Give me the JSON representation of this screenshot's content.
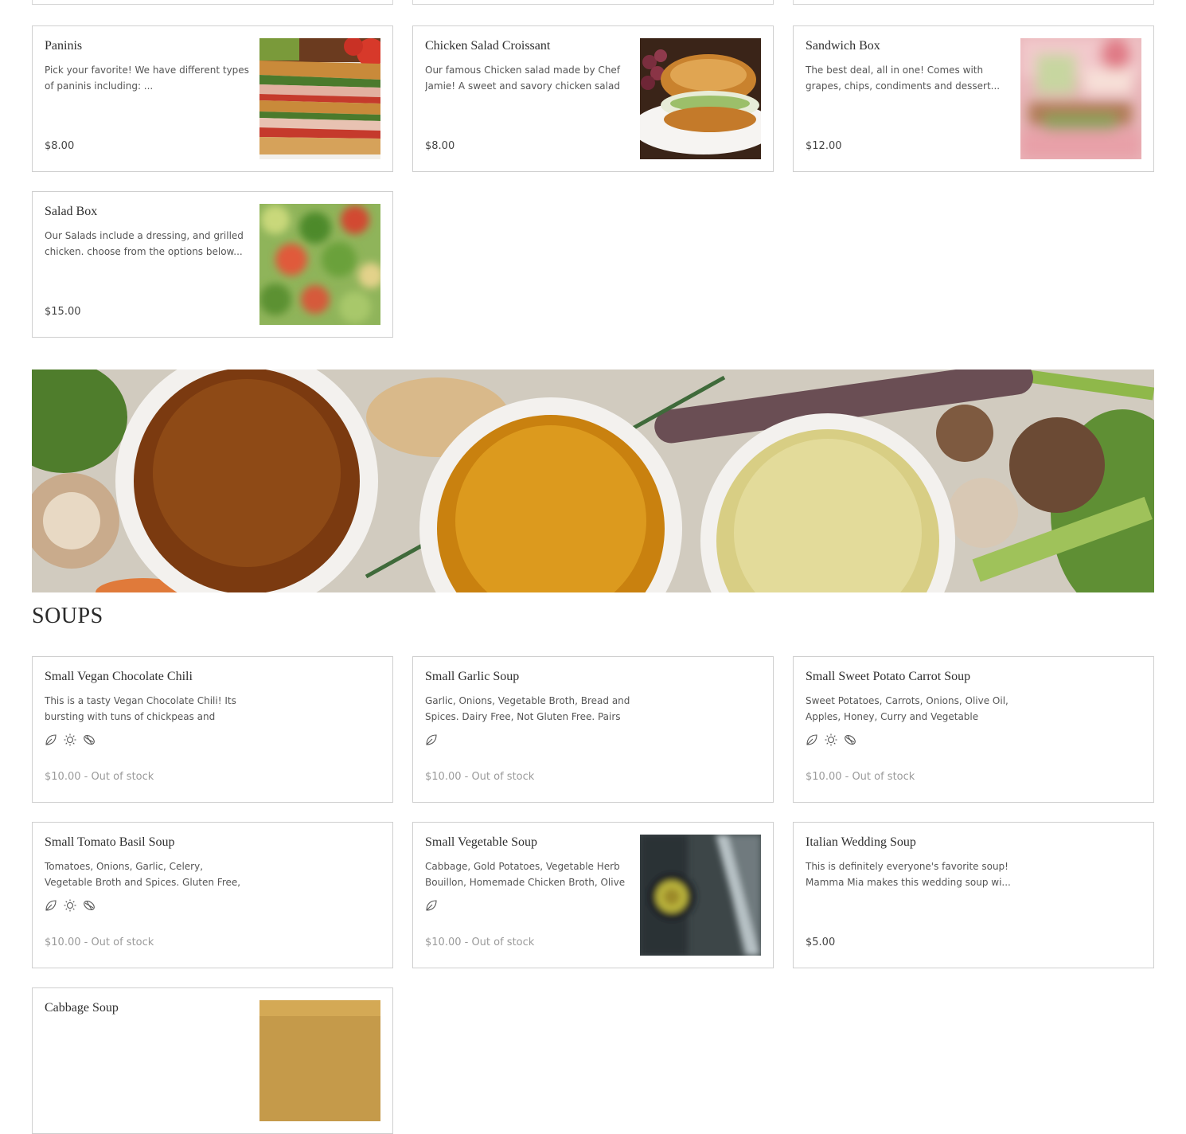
{
  "sandwiches": [
    {
      "title": "Paninis",
      "desc": "Pick your favorite! We have different types of paninis including: ...",
      "price": "$8.00",
      "image": "panini-photo"
    },
    {
      "title": "Chicken Salad Croissant",
      "desc": "Our famous Chicken salad made by Chef Jamie! A sweet and savory chicken salad ...",
      "price": "$8.00",
      "image": "croissant-photo"
    },
    {
      "title": "Sandwich Box",
      "desc": "The best deal, all in one! Comes with grapes, chips, condiments and dessert...",
      "price": "$12.00",
      "image": "sandwich-box-photo"
    },
    {
      "title": "Salad Box",
      "desc": "Our Salads include a dressing, and grilled chicken. choose from the options below...",
      "price": "$15.00",
      "image": "salad-photo"
    }
  ],
  "soups_section": {
    "title": "SOUPS"
  },
  "soups": [
    {
      "title": "Small Vegan Chocolate Chili",
      "desc": "This is a tasty Vegan Chocolate Chili! Its bursting with tuns of chickpeas and white...",
      "price": "$10.00 - Out of stock",
      "icons": [
        "vegan-leaf-icon",
        "spicy-sun-icon",
        "gluten-free-icon"
      ]
    },
    {
      "title": "Small Garlic Soup",
      "desc": "Garlic, Onions, Vegetable Broth, Bread and Spices. Dairy Free, Not Gluten Free. Pairs ...",
      "price": "$10.00 - Out of stock",
      "icons": [
        "vegan-leaf-icon"
      ]
    },
    {
      "title": "Small Sweet Potato Carrot Soup",
      "desc": "Sweet Potatoes, Carrots, Onions, Olive Oil, Apples, Honey, Curry and Vegetable Broth....",
      "price": "$10.00 - Out of stock",
      "icons": [
        "vegan-leaf-icon",
        "spicy-sun-icon",
        "gluten-free-icon"
      ]
    },
    {
      "title": "Small Tomato Basil Soup",
      "desc": "Tomatoes, Onions, Garlic, Celery, Vegetable Broth and Spices. Gluten Free, Dairy Free ...",
      "price": "$10.00 - Out of stock",
      "icons": [
        "vegan-leaf-icon",
        "spicy-sun-icon",
        "gluten-free-icon"
      ]
    },
    {
      "title": "Small Vegetable Soup",
      "desc": "Cabbage, Gold Potatoes, Vegetable Herb Bouillon, Homemade Chicken Broth, Olive ...",
      "price": "$10.00 - Out of stock",
      "icons": [
        "vegan-leaf-icon"
      ],
      "image": "vegetable-soup-photo"
    },
    {
      "title": "Italian Wedding Soup",
      "desc": "This is definitely everyone's favorite soup! Mamma Mia makes this wedding soup wi...",
      "price": "$5.00"
    },
    {
      "title": "Cabbage Soup",
      "image": "cabbage-soup-photo"
    }
  ]
}
